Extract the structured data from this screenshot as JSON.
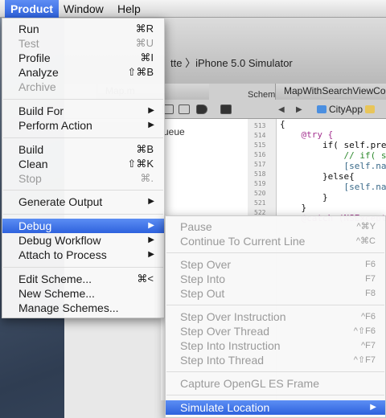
{
  "menubar": {
    "items": [
      {
        "label": "Product"
      },
      {
        "label": "Window"
      },
      {
        "label": "Help"
      }
    ]
  },
  "xcode": {
    "scheme_path": "tte 〉iPhone 5.0 Simulator",
    "scheme_tab": "Scheme",
    "file_tabs": [
      "Map.m",
      "MapWithSearchViewCor"
    ],
    "jump_crumb": "CityApp",
    "queue_label": "ueue",
    "line_numbers": [
      "513",
      "514",
      "515",
      "516",
      "517",
      "518",
      "519",
      "520",
      "521",
      "522"
    ],
    "code_lines": [
      "{",
      "    @try {",
      "        if( self.pre",
      "            // if( s",
      "            [self.na",
      "        }else{",
      "            [self.na",
      "        }",
      "    }",
      "    @catch (NSExcept"
    ]
  },
  "product_menu": {
    "title": "Product",
    "items": [
      {
        "label": "Run",
        "shortcut": "⌘R",
        "enabled": true
      },
      {
        "label": "Test",
        "shortcut": "⌘U",
        "enabled": false
      },
      {
        "label": "Profile",
        "shortcut": "⌘I",
        "enabled": true
      },
      {
        "label": "Analyze",
        "shortcut": "⇧⌘B",
        "enabled": true
      },
      {
        "label": "Archive",
        "shortcut": "",
        "enabled": false
      },
      {
        "label": "Build For",
        "submenu": true,
        "enabled": true
      },
      {
        "label": "Perform Action",
        "submenu": true,
        "enabled": true
      },
      {
        "label": "Build",
        "shortcut": "⌘B",
        "enabled": true
      },
      {
        "label": "Clean",
        "shortcut": "⇧⌘K",
        "enabled": true
      },
      {
        "label": "Stop",
        "shortcut": "⌘.",
        "enabled": false
      },
      {
        "label": "Generate Output",
        "submenu": true,
        "enabled": true
      },
      {
        "label": "Debug",
        "submenu": true,
        "enabled": true,
        "highlighted": true
      },
      {
        "label": "Debug Workflow",
        "submenu": true,
        "enabled": true
      },
      {
        "label": "Attach to Process",
        "submenu": true,
        "enabled": true
      },
      {
        "label": "Edit Scheme...",
        "shortcut": "⌘<",
        "enabled": true
      },
      {
        "label": "New Scheme...",
        "shortcut": "",
        "enabled": true
      },
      {
        "label": "Manage Schemes...",
        "shortcut": "",
        "enabled": true
      }
    ]
  },
  "debug_menu": {
    "items": [
      {
        "label": "Pause",
        "shortcut": "^⌘Y",
        "enabled": false
      },
      {
        "label": "Continue To Current Line",
        "shortcut": "^⌘C",
        "enabled": false
      },
      {
        "label": "Step Over",
        "shortcut": "F6",
        "enabled": false
      },
      {
        "label": "Step Into",
        "shortcut": "F7",
        "enabled": false
      },
      {
        "label": "Step Out",
        "shortcut": "F8",
        "enabled": false
      },
      {
        "label": "Step Over Instruction",
        "shortcut": "^F6",
        "enabled": false
      },
      {
        "label": "Step Over Thread",
        "shortcut": "^⇧F6",
        "enabled": false
      },
      {
        "label": "Step Into Instruction",
        "shortcut": "^F7",
        "enabled": false
      },
      {
        "label": "Step Into Thread",
        "shortcut": "^⇧F7",
        "enabled": false
      },
      {
        "label": "Capture OpenGL ES Frame",
        "shortcut": "",
        "enabled": false
      },
      {
        "label": "Simulate Location",
        "submenu": true,
        "enabled": true,
        "highlighted": true
      }
    ]
  },
  "colors": {
    "highlight": "#3a6ee6",
    "disabled_text": "#9a9a9a"
  }
}
